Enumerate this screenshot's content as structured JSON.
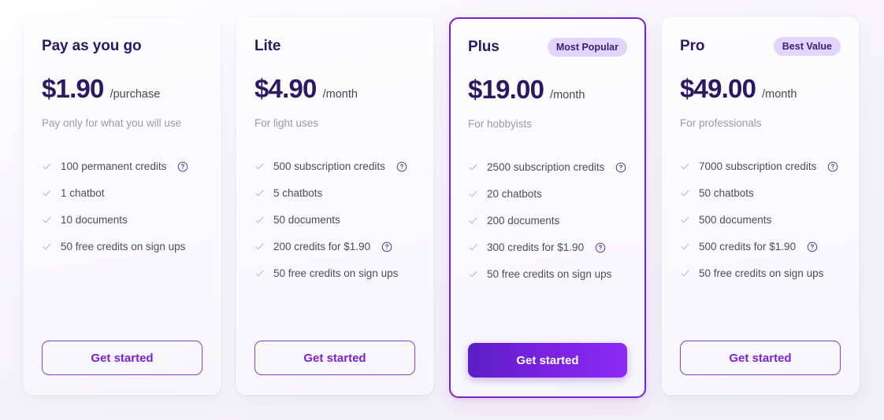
{
  "plans": [
    {
      "name": "Pay as you go",
      "badge": null,
      "price": "$1.90",
      "period": "/purchase",
      "tagline": "Pay only for what you will use",
      "featured": false,
      "features": [
        {
          "label": "100 permanent credits",
          "help": true
        },
        {
          "label": "1 chatbot",
          "help": false
        },
        {
          "label": "10 documents",
          "help": false
        },
        {
          "label": "50 free credits on sign ups",
          "help": false
        }
      ],
      "cta": "Get started"
    },
    {
      "name": "Lite",
      "badge": null,
      "price": "$4.90",
      "period": "/month",
      "tagline": "For light uses",
      "featured": false,
      "features": [
        {
          "label": "500 subscription credits",
          "help": true
        },
        {
          "label": "5 chatbots",
          "help": false
        },
        {
          "label": "50 documents",
          "help": false
        },
        {
          "label": "200 credits for $1.90",
          "help": true
        },
        {
          "label": "50 free credits on sign ups",
          "help": false
        }
      ],
      "cta": "Get started"
    },
    {
      "name": "Plus",
      "badge": "Most Popular",
      "price": "$19.00",
      "period": "/month",
      "tagline": "For hobbyists",
      "featured": true,
      "features": [
        {
          "label": "2500 subscription credits",
          "help": true
        },
        {
          "label": "20 chatbots",
          "help": false
        },
        {
          "label": "200 documents",
          "help": false
        },
        {
          "label": "300 credits for $1.90",
          "help": true
        },
        {
          "label": "50 free credits on sign ups",
          "help": false
        }
      ],
      "cta": "Get started"
    },
    {
      "name": "Pro",
      "badge": "Best Value",
      "price": "$49.00",
      "period": "/month",
      "tagline": "For professionals",
      "featured": false,
      "features": [
        {
          "label": "7000 subscription credits",
          "help": true
        },
        {
          "label": "50 chatbots",
          "help": false
        },
        {
          "label": "500 documents",
          "help": false
        },
        {
          "label": "500 credits for $1.90",
          "help": true
        },
        {
          "label": "50 free credits on sign ups",
          "help": false
        }
      ],
      "cta": "Get started"
    }
  ],
  "icons": {
    "check": "check-icon",
    "help": "help-circle-icon"
  },
  "colors": {
    "accent": "#7c22ce",
    "heading": "#2b1a63",
    "badge_bg": "#e3d4fb",
    "badge_text": "#3b1e73",
    "muted": "#9c98a8"
  }
}
